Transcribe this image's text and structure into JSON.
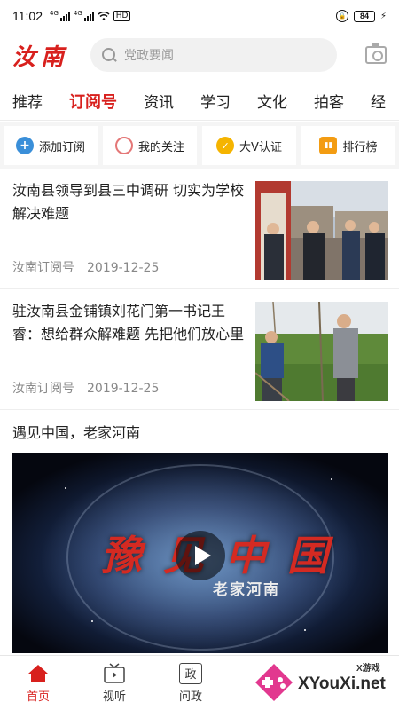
{
  "status_bar": {
    "time": "11:02",
    "hd_label": "HD",
    "battery": "84"
  },
  "header": {
    "logo": "汝南",
    "search_placeholder": "党政要闻",
    "icons": [
      "search-icon",
      "camera-icon"
    ]
  },
  "tabs": [
    {
      "label": "推荐"
    },
    {
      "label": "订阅号",
      "active": true
    },
    {
      "label": "资讯"
    },
    {
      "label": "学习"
    },
    {
      "label": "文化"
    },
    {
      "label": "拍客"
    },
    {
      "label": "经"
    }
  ],
  "quick_actions": [
    {
      "label": "添加订阅",
      "icon": "plus-circle-icon"
    },
    {
      "label": "我的关注",
      "icon": "circle-icon"
    },
    {
      "label": "大V认证",
      "icon": "v-badge-icon"
    },
    {
      "label": "排行榜",
      "icon": "bar-chart-icon"
    }
  ],
  "news": [
    {
      "title": "汝南县领导到县三中调研 切实为学校解决难题",
      "source": "汝南订阅号",
      "date": "2019-12-25"
    },
    {
      "title": "驻汝南县金铺镇刘花门第一书记王睿：想给群众解难题 先把他们放心里",
      "source": "汝南订阅号",
      "date": "2019-12-25"
    }
  ],
  "video": {
    "section_title": "遇见中国，老家河南",
    "overlay_main": "豫见中国",
    "overlay_sub": "老家河南"
  },
  "bottom_nav": [
    {
      "label": "首页",
      "icon": "home-icon",
      "active": true
    },
    {
      "label": "视听",
      "icon": "tv-icon"
    },
    {
      "label": "问政",
      "icon": "zheng-icon",
      "glyph": "政"
    }
  ],
  "watermark": {
    "text": "XYouXi.net",
    "small": "X游戏"
  },
  "colors": {
    "brand_red": "#d8201d",
    "quick_bar_bg": "#f5f5f5"
  }
}
